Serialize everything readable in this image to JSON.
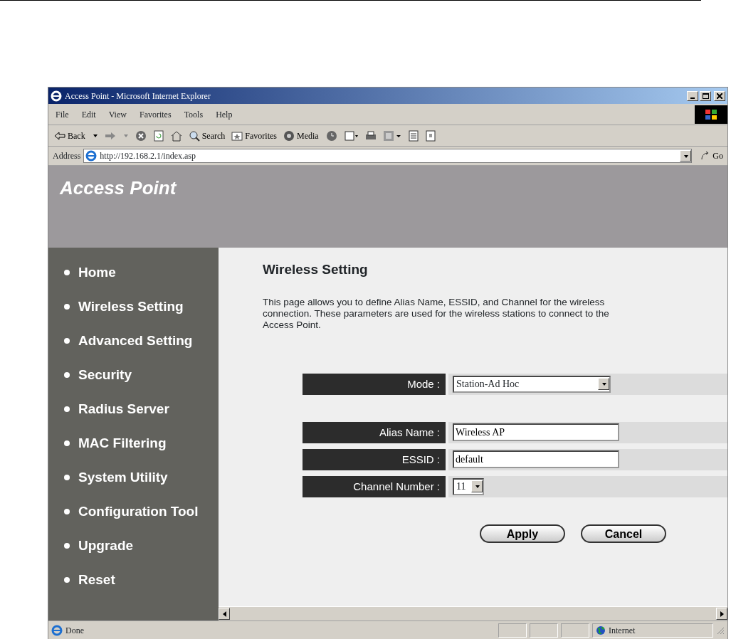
{
  "window": {
    "title": "Access Point - Microsoft Internet Explorer"
  },
  "menu": [
    "File",
    "Edit",
    "View",
    "Favorites",
    "Tools",
    "Help"
  ],
  "toolbar": {
    "back": "Back",
    "search": "Search",
    "favorites": "Favorites",
    "media": "Media"
  },
  "address": {
    "label": "Address",
    "url": "http://192.168.2.1/index.asp",
    "go": "Go"
  },
  "site": {
    "title": "Access Point"
  },
  "sidebar": {
    "items": [
      "Home",
      "Wireless Setting",
      "Advanced Setting",
      "Security",
      "Radius Server",
      "MAC Filtering",
      "System Utility",
      "Configuration Tool",
      "Upgrade",
      "Reset"
    ]
  },
  "content": {
    "heading": "Wireless Setting",
    "description": "This page allows you to define Alias Name, ESSID, and Channel for the wireless connection. These parameters are used for the wireless stations to connect to the Access Point.",
    "form_groups": [
      [
        {
          "kind": "wide_select",
          "label": "Mode :",
          "value": "Station-Ad Hoc"
        }
      ],
      [
        {
          "kind": "text",
          "label": "Alias Name :",
          "value": "Wireless AP"
        },
        {
          "kind": "text",
          "label": "ESSID :",
          "value": "default"
        },
        {
          "kind": "narrow_select",
          "label": "Channel Number :",
          "value": "11"
        }
      ]
    ],
    "buttons": [
      "Apply",
      "Cancel"
    ]
  },
  "status_bar": {
    "text": "Done",
    "zone": "Internet"
  }
}
